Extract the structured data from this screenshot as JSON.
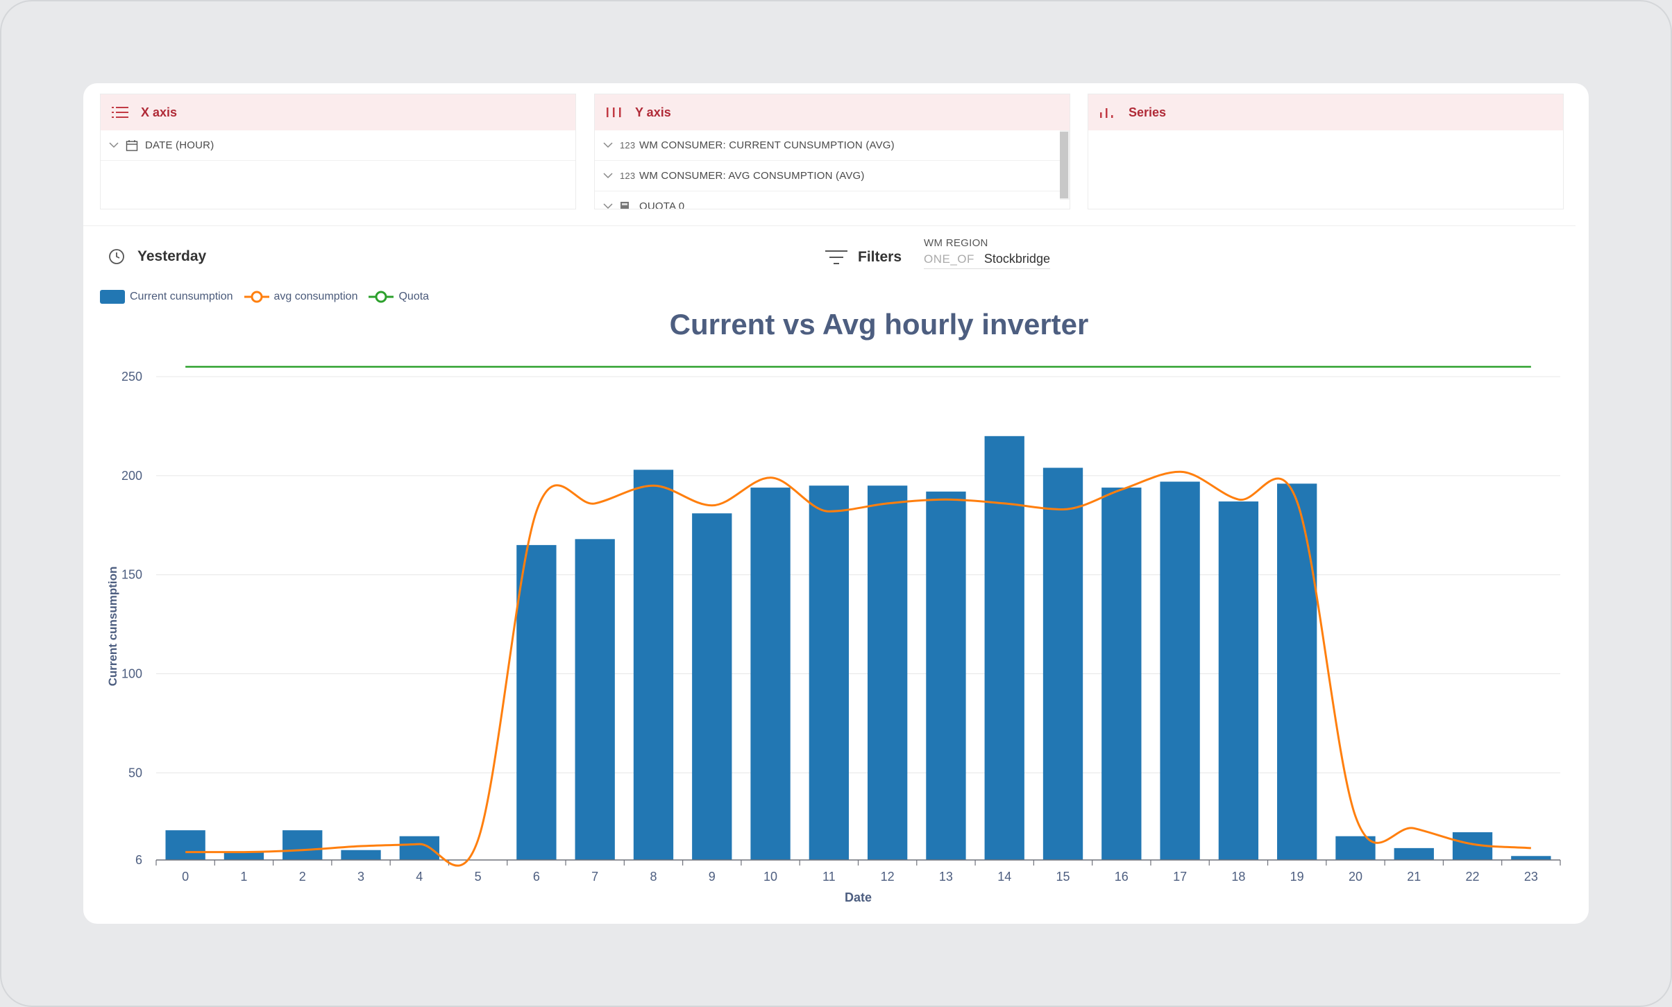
{
  "panels": {
    "x_axis": {
      "title": "X axis",
      "icon": "list-icon",
      "rows": [
        {
          "label": "DATE (HOUR)",
          "icon": "calendar-icon"
        }
      ]
    },
    "y_axis": {
      "title": "Y axis",
      "icon": "bars-icon",
      "rows": [
        {
          "label": "WM CONSUMER: CURRENT CUNSUMPTION (AVG)",
          "icon": "123"
        },
        {
          "label": "WM CONSUMER: AVG CONSUMPTION (AVG)",
          "icon": "123"
        },
        {
          "label": "QUOTA 0",
          "icon": "calculator-icon"
        }
      ]
    },
    "series": {
      "title": "Series",
      "icon": "series-chart-icon"
    }
  },
  "time_range": {
    "label": "Yesterday",
    "icon": "clock-icon"
  },
  "filters": {
    "label": "Filters",
    "icon": "filter-icon",
    "field": "WM REGION",
    "operator": "ONE_OF",
    "value": "Stockbridge"
  },
  "colors": {
    "bar": "#2277b3",
    "avg_line": "#ff7f0e",
    "quota_line": "#2ca02c",
    "title": "#4d5e80",
    "accent_red": "#b02a37"
  },
  "chart_data": {
    "type": "bar",
    "title": "Current vs Avg hourly inverter",
    "xlabel": "Date",
    "ylabel": "Current cunsumption",
    "categories": [
      "0",
      "1",
      "2",
      "3",
      "4",
      "5",
      "6",
      "7",
      "8",
      "9",
      "10",
      "11",
      "12",
      "13",
      "14",
      "15",
      "16",
      "17",
      "18",
      "19",
      "20",
      "21",
      "22",
      "23"
    ],
    "y_ticks": [
      "6",
      "50",
      "100",
      "150",
      "200",
      "250"
    ],
    "ylim": [
      6,
      256
    ],
    "grid": true,
    "legend_position": "top-left",
    "series": [
      {
        "name": "Current cunsumption",
        "type": "bar",
        "values": [
          21,
          10,
          21,
          11,
          18,
          6,
          165,
          168,
          203,
          181,
          194,
          195,
          195,
          192,
          220,
          204,
          194,
          197,
          187,
          196,
          18,
          12,
          20,
          8
        ]
      },
      {
        "name": "avg consumption",
        "type": "line",
        "smooth": true,
        "values": [
          10,
          10,
          11,
          13,
          14,
          16,
          182,
          186,
          195,
          185,
          199,
          182,
          186,
          188,
          186,
          183,
          193,
          202,
          188,
          187,
          28,
          22,
          14,
          12
        ]
      },
      {
        "name": "Quota",
        "type": "line",
        "values": [
          255,
          255,
          255,
          255,
          255,
          255,
          255,
          255,
          255,
          255,
          255,
          255,
          255,
          255,
          255,
          255,
          255,
          255,
          255,
          255,
          255,
          255,
          255,
          255
        ]
      }
    ]
  }
}
